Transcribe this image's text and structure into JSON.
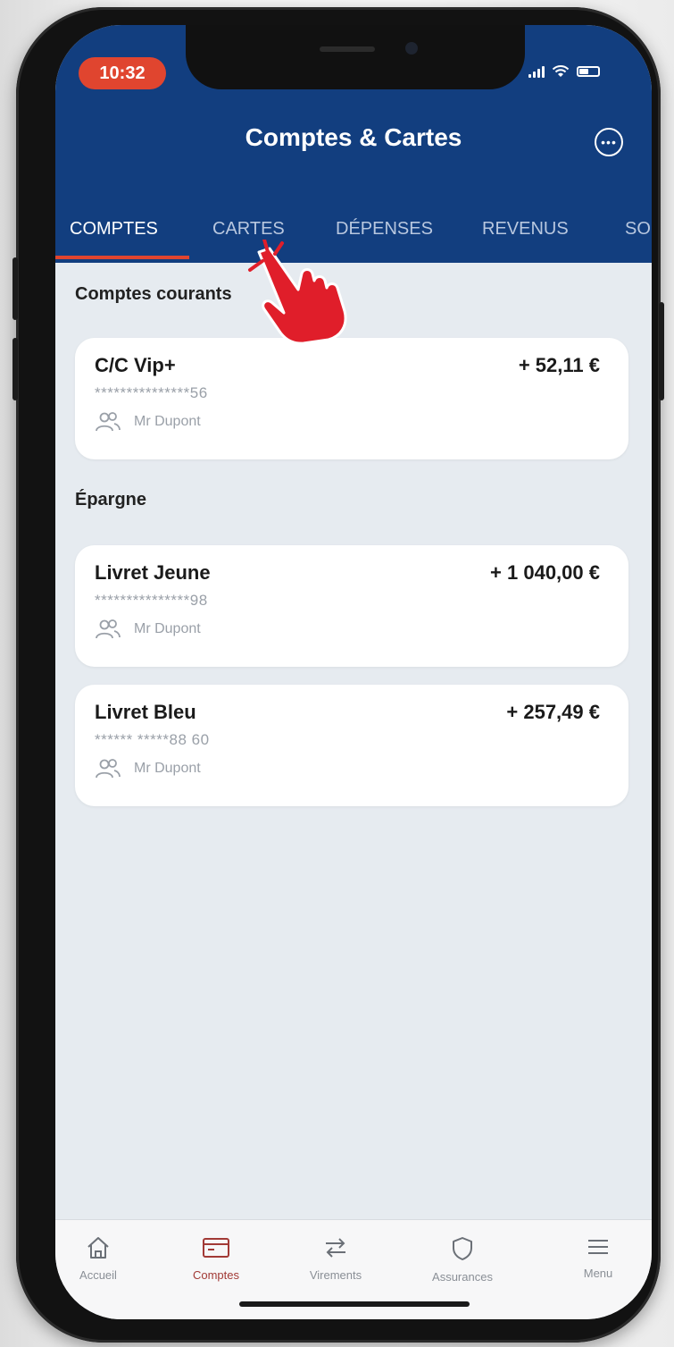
{
  "status_bar": {
    "time": "10:32"
  },
  "header": {
    "title": "Comptes & Cartes"
  },
  "tabs": [
    {
      "label": "COMPTES",
      "active": true
    },
    {
      "label": "CARTES",
      "active": false
    },
    {
      "label": "DÉPENSES",
      "active": false
    },
    {
      "label": "REVENUS",
      "active": false
    },
    {
      "label": "SO",
      "active": false
    }
  ],
  "sections": {
    "current": {
      "label": "Comptes courants",
      "accounts": [
        {
          "name": "C/C Vip+",
          "number": "***************56",
          "amount": "+ 52,11 €",
          "owner": "Mr Dupont"
        }
      ]
    },
    "savings": {
      "label": "Épargne",
      "accounts": [
        {
          "name": "Livret Jeune",
          "number": "***************98",
          "amount": "+ 1 040,00 €",
          "owner": "Mr Dupont"
        },
        {
          "name": "Livret Bleu",
          "number": "****** *****88 60",
          "amount": "+ 257,49 €",
          "owner": "Mr Dupont"
        }
      ]
    }
  },
  "bottom_nav": [
    {
      "label": "Accueil",
      "icon": "home-icon",
      "active": false
    },
    {
      "label": "Comptes",
      "icon": "card-icon",
      "active": true
    },
    {
      "label": "Virements",
      "icon": "transfer-icon",
      "active": false
    },
    {
      "label": "Assurances",
      "icon": "shield-icon",
      "active": false
    },
    {
      "label": "Menu",
      "icon": "menu-icon",
      "active": false
    }
  ],
  "colors": {
    "header": "#123e7f",
    "accent": "#e0452f",
    "background": "#e6ebf0",
    "active_nav": "#a23a36",
    "pointer_hand": "#e01e2a"
  }
}
